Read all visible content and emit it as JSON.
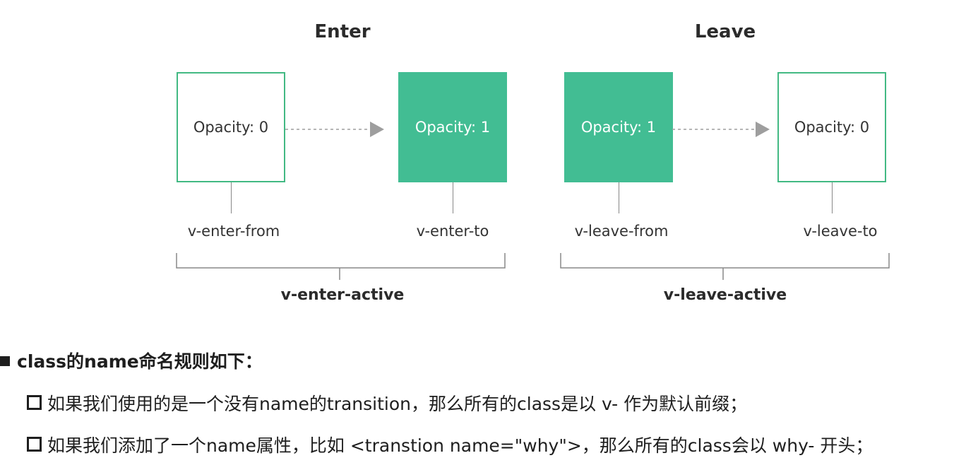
{
  "diagram": {
    "enter": {
      "heading": "Enter",
      "from_box": "Opacity: 0",
      "to_box": "Opacity: 1",
      "from_label": "v-enter-from",
      "to_label": "v-enter-to",
      "active_label": "v-enter-active"
    },
    "leave": {
      "heading": "Leave",
      "from_box": "Opacity: 1",
      "to_box": "Opacity: 0",
      "from_label": "v-leave-from",
      "to_label": "v-leave-to",
      "active_label": "v-leave-active"
    },
    "colors": {
      "accent": "#42b983",
      "filled_box": "#42bd93",
      "arrow": "#9e9e9e",
      "bracket": "#888888"
    }
  },
  "rules": {
    "title": "class的name命名规则如下：",
    "items": [
      "如果我们使用的是一个没有name的transition，那么所有的class是以 v- 作为默认前缀；",
      "如果我们添加了一个name属性，比如 <transtion name=\"why\">，那么所有的class会以 why- 开头；"
    ]
  }
}
